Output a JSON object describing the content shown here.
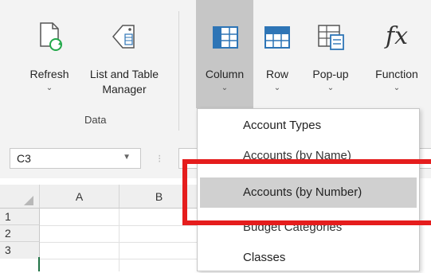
{
  "ribbon": {
    "buttons": [
      {
        "label": "Refresh",
        "chevron": "⌄",
        "icon": "refresh-document-icon"
      },
      {
        "label": "List and Table\nManager",
        "icon": "list-tag-icon"
      },
      {
        "label": "Column",
        "chevron": "⌄",
        "icon": "table-column-icon"
      },
      {
        "label": "Row",
        "chevron": "⌄",
        "icon": "table-row-icon"
      },
      {
        "label": "Pop-up",
        "chevron": "⌄",
        "icon": "table-popup-icon"
      },
      {
        "label": "Function",
        "chevron": "⌄",
        "icon": "fx-icon",
        "glyph": "fx"
      }
    ],
    "group_label": "Data"
  },
  "formula_bar": {
    "name_box": "C3",
    "dropdown": "▼",
    "dots": "⁝"
  },
  "grid": {
    "columns": [
      "",
      "A",
      "B"
    ],
    "rows": [
      "1",
      "2",
      "3"
    ]
  },
  "menu": {
    "items": [
      "Account Types",
      "Accounts (by Name)",
      "Accounts (by Number)",
      "Budget Categories",
      "Classes"
    ],
    "highlighted_index": 2
  },
  "colors": {
    "highlight": "#e51d1d",
    "accent_green": "#22a84a",
    "icon_blue": "#2e75b6"
  }
}
